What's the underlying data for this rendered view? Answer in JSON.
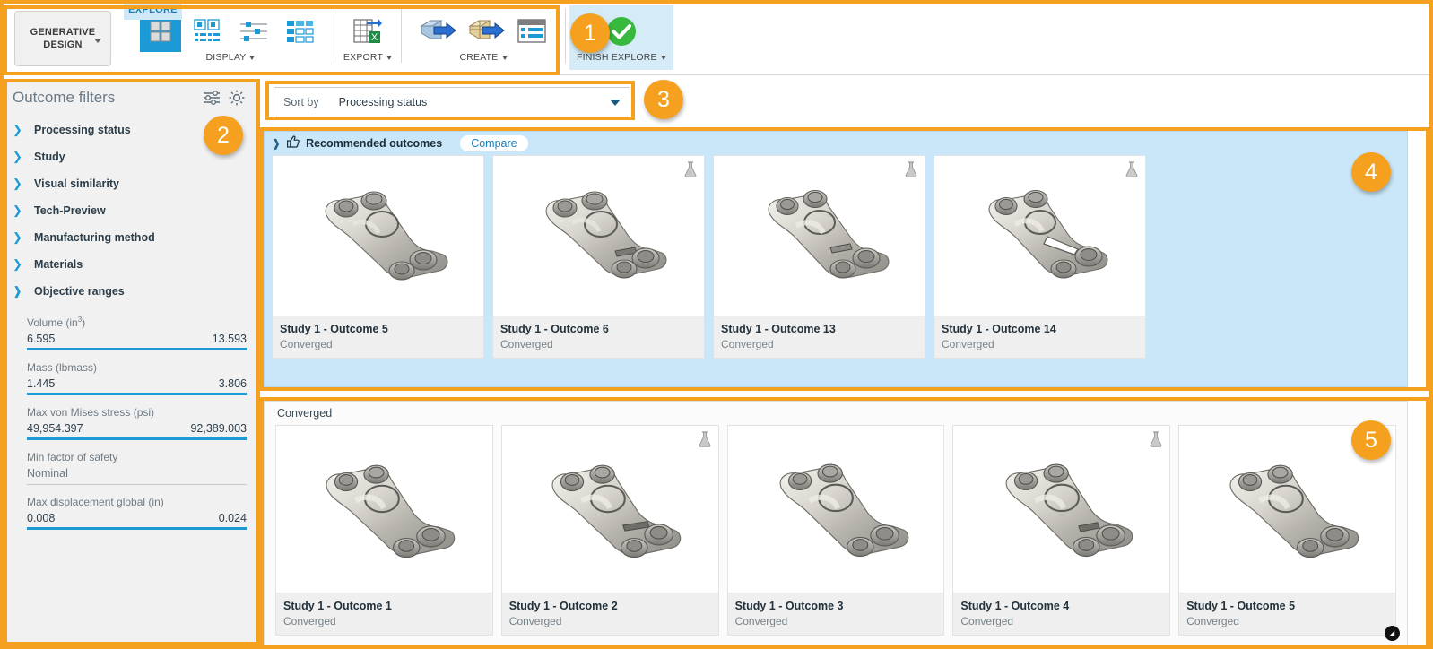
{
  "app": {
    "product_button": "GENERATIVE\nDESIGN",
    "product_button_line1": "GENERATIVE",
    "product_button_line2": "DESIGN",
    "tab": "EXPLORE"
  },
  "ribbon": {
    "groups": [
      {
        "label": "DISPLAY",
        "has_dropdown": true,
        "icons": [
          {
            "name": "thumbnail-grid-view-icon",
            "active": true
          },
          {
            "name": "thumbnail-list-view-icon",
            "active": false
          },
          {
            "name": "scatter-plot-view-icon",
            "active": false
          },
          {
            "name": "table-view-icon",
            "active": false
          }
        ]
      },
      {
        "label": "EXPORT",
        "has_dropdown": true,
        "icons": [
          {
            "name": "export-spreadsheet-icon",
            "active": false
          }
        ]
      },
      {
        "label": "CREATE",
        "has_dropdown": true,
        "icons": [
          {
            "name": "create-solid-body-icon",
            "active": false
          },
          {
            "name": "create-mesh-body-icon",
            "active": false
          },
          {
            "name": "create-report-icon",
            "active": false
          }
        ]
      },
      {
        "label": "FINISH EXPLORE",
        "has_dropdown": true,
        "icons": [
          {
            "name": "finish-explore-check-icon",
            "active": false
          }
        ]
      }
    ]
  },
  "sidebar": {
    "title": "Outcome filters",
    "header_icons": [
      "filter-sliders-icon",
      "gear-icon"
    ],
    "filters": [
      {
        "label": "Processing status",
        "expanded": false
      },
      {
        "label": "Study",
        "expanded": false
      },
      {
        "label": "Visual similarity",
        "expanded": false
      },
      {
        "label": "Tech-Preview",
        "expanded": false
      },
      {
        "label": "Manufacturing method",
        "expanded": false
      },
      {
        "label": "Materials",
        "expanded": false
      },
      {
        "label": "Objective ranges",
        "expanded": true
      }
    ],
    "objective_ranges": [
      {
        "label": "Volume (in³)",
        "min": "6.595",
        "max": "13.593",
        "active": true
      },
      {
        "label": "Mass (lbmass)",
        "min": "1.445",
        "max": "3.806",
        "active": true
      },
      {
        "label": "Max von Mises stress (psi)",
        "min": "49,954.397",
        "max": "92,389.003",
        "active": true
      },
      {
        "label": "Min factor of safety",
        "min": "Nominal",
        "max": "",
        "active": false
      },
      {
        "label": "Max displacement global (in)",
        "min": "0.008",
        "max": "0.024",
        "active": true
      }
    ]
  },
  "sort": {
    "label": "Sort by",
    "value": "Processing status"
  },
  "recommended": {
    "title": "Recommended outcomes",
    "compare_label": "Compare",
    "expanded": true,
    "cards": [
      {
        "name": "Study 1 - Outcome 5",
        "status": "Converged",
        "flask": false
      },
      {
        "name": "Study 1 - Outcome 6",
        "status": "Converged",
        "flask": true
      },
      {
        "name": "Study 1 - Outcome 13",
        "status": "Converged",
        "flask": true
      },
      {
        "name": "Study 1 - Outcome 14",
        "status": "Converged",
        "flask": true
      }
    ]
  },
  "converged": {
    "title": "Converged",
    "cards": [
      {
        "name": "Study 1 - Outcome 1",
        "status": "Converged",
        "flask": false
      },
      {
        "name": "Study 1 - Outcome 2",
        "status": "Converged",
        "flask": true
      },
      {
        "name": "Study 1 - Outcome 3",
        "status": "Converged",
        "flask": false
      },
      {
        "name": "Study 1 - Outcome 4",
        "status": "Converged",
        "flask": true
      },
      {
        "name": "Study 1 - Outcome 5",
        "status": "Converged",
        "flask": true
      }
    ]
  },
  "annotations": [
    {
      "number": "1"
    },
    {
      "number": "2"
    },
    {
      "number": "3"
    },
    {
      "number": "4"
    },
    {
      "number": "5"
    }
  ],
  "colors": {
    "accent_orange": "#f5a01e",
    "accent_blue": "#1c9ad6",
    "highlight_panel": "#c9e7f8",
    "sidebar_bg": "#f1f1f1"
  }
}
